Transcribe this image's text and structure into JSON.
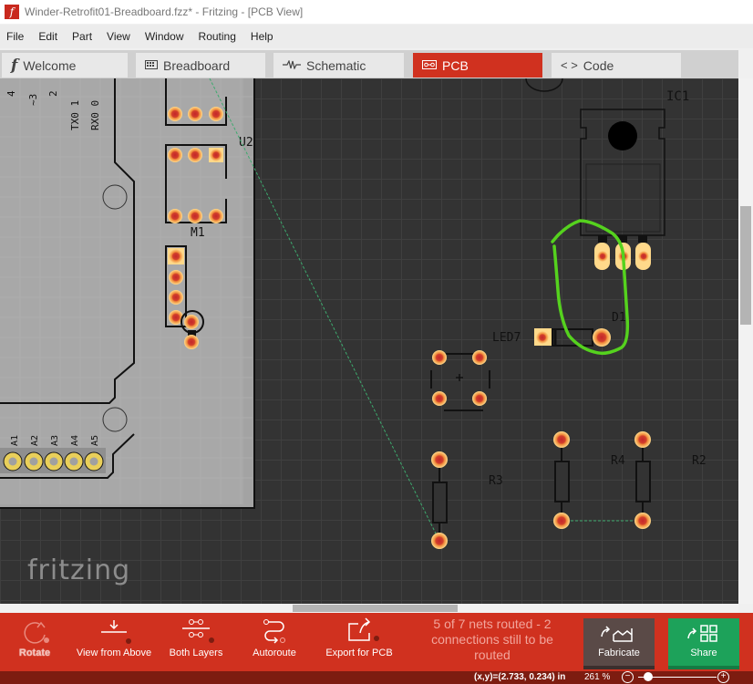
{
  "window": {
    "title": "Winder-Retrofit01-Breadboard.fzz* - Fritzing - [PCB View]",
    "app_icon": "fritzing-f-icon"
  },
  "menu": [
    "File",
    "Edit",
    "Part",
    "View",
    "Window",
    "Routing",
    "Help"
  ],
  "tabs": [
    {
      "label": "Welcome",
      "icon": "fritzing-f-icon",
      "active": false
    },
    {
      "label": "Breadboard",
      "icon": "breadboard-icon",
      "active": false
    },
    {
      "label": "Schematic",
      "icon": "resistor-icon",
      "active": false
    },
    {
      "label": "PCB",
      "icon": "pcb-icon",
      "active": true
    },
    {
      "label": "Code",
      "icon": "code-icon",
      "active": false
    }
  ],
  "canvas": {
    "logo": "fritzing",
    "part_labels": {
      "u2": "U2",
      "m1": "M1",
      "ic1": "IC1",
      "d1": "D1",
      "led7": "LED7",
      "r2": "R2",
      "r3": "R3",
      "r4": "R4"
    },
    "arduino_pins_top": [
      "4",
      "~3",
      "2",
      "TX0 1",
      "RX0 0"
    ],
    "arduino_pins_bottom": [
      "A1",
      "A2",
      "A3",
      "A4",
      "A5"
    ],
    "annotation_color": "#55d21e"
  },
  "toolbar": {
    "rotate": "Rotate",
    "view_from_above": "View from Above",
    "both_layers": "Both Layers",
    "autoroute": "Autoroute",
    "export_for_pcb": "Export for PCB",
    "routing_status": "5 of 7 nets routed - 2 connections still to be routed",
    "fabricate": "Fabricate",
    "share": "Share"
  },
  "statusbar": {
    "coords": "(x,y)=(2.733, 0.234) in",
    "zoom": "261 %",
    "zoom_minus": "−",
    "zoom_plus": "+"
  },
  "colors": {
    "accent": "#d0311f",
    "share": "#1da25a",
    "fabricate": "#5a4a47",
    "canvas": "#333333"
  }
}
